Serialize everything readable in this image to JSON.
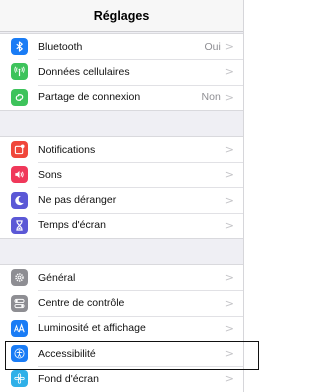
{
  "header": {
    "title": "Réglages"
  },
  "groups": [
    [
      {
        "label": "Bluetooth",
        "value": "Oui",
        "icon": "bluetooth-icon",
        "color": "#1a7cf5"
      },
      {
        "label": "Données cellulaires",
        "value": "",
        "icon": "cellular-antenna-icon",
        "color": "#3dc35b"
      },
      {
        "label": "Partage de connexion",
        "value": "Non",
        "icon": "hotspot-chain-icon",
        "color": "#3dc35b"
      }
    ],
    [
      {
        "label": "Notifications",
        "value": "",
        "icon": "notifications-icon",
        "color": "#f0463a"
      },
      {
        "label": "Sons",
        "value": "",
        "icon": "speaker-icon",
        "color": "#f0385a"
      },
      {
        "label": "Ne pas déranger",
        "value": "",
        "icon": "moon-icon",
        "color": "#5b58d6"
      },
      {
        "label": "Temps d'écran",
        "value": "",
        "icon": "hourglass-icon",
        "color": "#5b58d6"
      }
    ],
    [
      {
        "label": "Général",
        "value": "",
        "icon": "gear-icon",
        "color": "#8e8e93"
      },
      {
        "label": "Centre de contrôle",
        "value": "",
        "icon": "toggles-icon",
        "color": "#8e8e93"
      },
      {
        "label": "Luminosité et affichage",
        "value": "",
        "icon": "text-size-icon",
        "color": "#1a7cf5"
      },
      {
        "label": "Accessibilité",
        "value": "",
        "icon": "accessibility-icon",
        "color": "#1a7cf5"
      },
      {
        "label": "Fond d'écran",
        "value": "",
        "icon": "flower-icon",
        "color": "#2fb0e8"
      }
    ]
  ],
  "chevron": ">"
}
